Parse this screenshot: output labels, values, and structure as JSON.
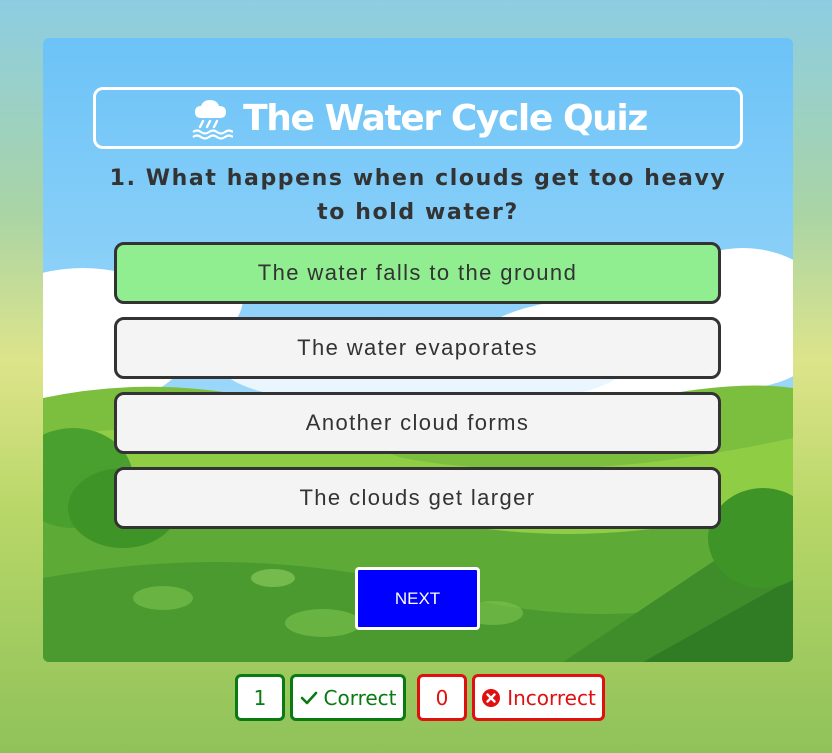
{
  "quiz": {
    "title": "The Water Cycle Quiz",
    "title_icon": "cloud-rain-icon",
    "question": "1. What happens when clouds get too heavy to hold water?",
    "answers": [
      {
        "label": "The water falls to the ground",
        "state": "correct"
      },
      {
        "label": "The water evaporates",
        "state": "default"
      },
      {
        "label": "Another cloud forms",
        "state": "default"
      },
      {
        "label": "The clouds get larger",
        "state": "default"
      }
    ],
    "next_label": "NEXT"
  },
  "score": {
    "correct_count": "1",
    "correct_label": "Correct",
    "incorrect_count": "0",
    "incorrect_label": "Incorrect"
  },
  "colors": {
    "correct_answer_bg": "#90ee90",
    "next_button": "#0000ff",
    "correct": "#0a7a12",
    "incorrect": "#e01010"
  }
}
